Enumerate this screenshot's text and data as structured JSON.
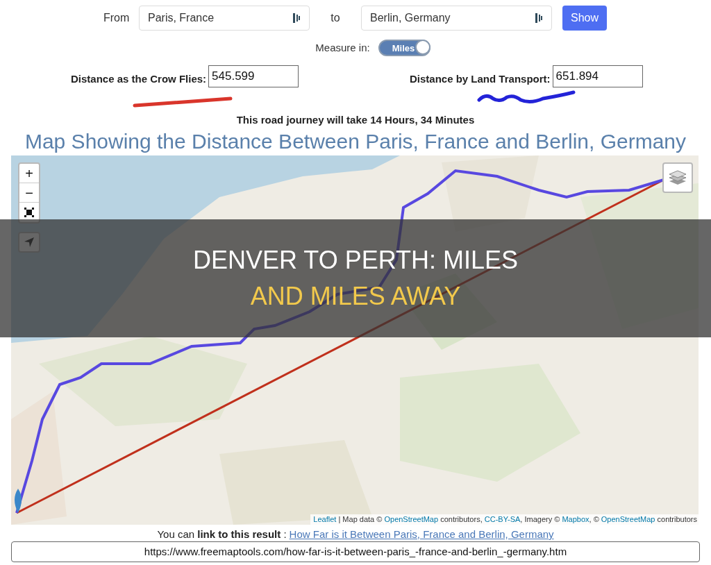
{
  "route_form": {
    "from_label": "From",
    "from_value": "Paris, France",
    "to_label": "to",
    "to_value": "Berlin, Germany",
    "show_button": "Show"
  },
  "measure": {
    "label": "Measure in:",
    "toggle_label": "Miles",
    "on": true
  },
  "distances": [
    {
      "label": "Distance as the Crow Flies:",
      "value": "545.599"
    },
    {
      "label": "Distance by Land Transport:",
      "value": "651.894"
    }
  ],
  "journey": "This road journey will take 14 Hours, 34 Minutes",
  "heading": "Map Showing the Distance Between Paris, France and Berlin, Germany",
  "map": {
    "kind": "picture",
    "controls": [
      {
        "kind": "zoom-in",
        "label": "+"
      },
      {
        "kind": "zoom-out",
        "label": "−"
      },
      {
        "kind": "fullscreen"
      },
      {
        "kind": "locate"
      }
    ],
    "attribution": [
      {
        "text": "Leaflet",
        "link": true
      },
      {
        "text": " | Map data © ",
        "link": false
      },
      {
        "text": "OpenStreetMap",
        "link": true
      },
      {
        "text": " contributors, ",
        "link": false
      },
      {
        "text": "CC-BY-SA",
        "link": true
      },
      {
        "text": ", Imagery © ",
        "link": false
      },
      {
        "text": "Mapbox",
        "link": true
      },
      {
        "text": ", © ",
        "link": false
      },
      {
        "text": "OpenStreetMap",
        "link": true
      },
      {
        "text": " contributors",
        "link": false
      }
    ]
  },
  "link_line": {
    "text": "You can **link to this result** :",
    "link": "How Far is it Between Paris, France and Berlin, Germany"
  },
  "url_field": "https://www.freemaptools.com/how-far-is-it-between-paris_-france-and-berlin_-germany.htm",
  "overlay_title": [
    "DENVER TO PERTH: MILES",
    "AND MILES AWAY"
  ]
}
